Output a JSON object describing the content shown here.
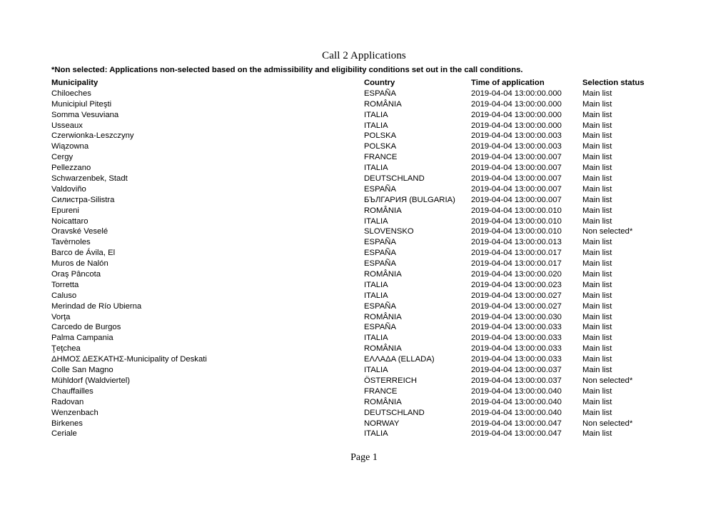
{
  "document": {
    "title": "Call 2 Applications",
    "note": "*Non selected: Applications non-selected based on the admissibility and eligibility conditions set out in the call conditions.",
    "footer": "Page 1"
  },
  "table": {
    "columns": {
      "municipality": "Municipality",
      "country": "Country",
      "time": "Time of application",
      "status": "Selection status"
    },
    "rows": [
      {
        "municipality": "Chiloeches",
        "country": "ESPAÑA",
        "time": "2019-04-04 13:00:00.000",
        "status": "Main list"
      },
      {
        "municipality": "Municipiul Piteşti",
        "country": "ROMÂNIA",
        "time": "2019-04-04 13:00:00.000",
        "status": "Main list"
      },
      {
        "municipality": "Somma Vesuviana",
        "country": "ITALIA",
        "time": "2019-04-04 13:00:00.000",
        "status": "Main list"
      },
      {
        "municipality": "Usseaux",
        "country": "ITALIA",
        "time": "2019-04-04 13:00:00.000",
        "status": "Main list"
      },
      {
        "municipality": "Czerwionka-Leszczyny",
        "country": "POLSKA",
        "time": "2019-04-04 13:00:00.003",
        "status": "Main list"
      },
      {
        "municipality": "Wiązowna",
        "country": "POLSKA",
        "time": "2019-04-04 13:00:00.003",
        "status": "Main list"
      },
      {
        "municipality": "Cergy",
        "country": "FRANCE",
        "time": "2019-04-04 13:00:00.007",
        "status": "Main list"
      },
      {
        "municipality": "Pellezzano",
        "country": "ITALIA",
        "time": "2019-04-04 13:00:00.007",
        "status": "Main list"
      },
      {
        "municipality": "Schwarzenbek, Stadt",
        "country": "DEUTSCHLAND",
        "time": "2019-04-04 13:00:00.007",
        "status": "Main list"
      },
      {
        "municipality": "Valdoviño",
        "country": "ESPAÑA",
        "time": "2019-04-04 13:00:00.007",
        "status": "Main list"
      },
      {
        "municipality": "Силистра-Silistra",
        "country": "БЪЛГАРИЯ (BULGARIA)",
        "time": "2019-04-04 13:00:00.007",
        "status": "Main list"
      },
      {
        "municipality": "Epureni",
        "country": "ROMÂNIA",
        "time": "2019-04-04 13:00:00.010",
        "status": "Main list"
      },
      {
        "municipality": "Noicattaro",
        "country": "ITALIA",
        "time": "2019-04-04 13:00:00.010",
        "status": "Main list"
      },
      {
        "municipality": "Oravské Veselé",
        "country": "SLOVENSKO",
        "time": "2019-04-04 13:00:00.010",
        "status": "Non selected*"
      },
      {
        "municipality": "Tavèrnoles",
        "country": "ESPAÑA",
        "time": "2019-04-04 13:00:00.013",
        "status": "Main list"
      },
      {
        "municipality": "Barco de Ávila, El",
        "country": "ESPAÑA",
        "time": "2019-04-04 13:00:00.017",
        "status": "Main list"
      },
      {
        "municipality": "Muros de Nalón",
        "country": "ESPAÑA",
        "time": "2019-04-04 13:00:00.017",
        "status": "Main list"
      },
      {
        "municipality": "Oraş Pâncota",
        "country": "ROMÂNIA",
        "time": "2019-04-04 13:00:00.020",
        "status": "Main list"
      },
      {
        "municipality": "Torretta",
        "country": "ITALIA",
        "time": "2019-04-04 13:00:00.023",
        "status": "Main list"
      },
      {
        "municipality": "Caluso",
        "country": "ITALIA",
        "time": "2019-04-04 13:00:00.027",
        "status": "Main list"
      },
      {
        "municipality": "Merindad de Río Ubierna",
        "country": "ESPAÑA",
        "time": "2019-04-04 13:00:00.027",
        "status": "Main list"
      },
      {
        "municipality": "Vorţa",
        "country": "ROMÂNIA",
        "time": "2019-04-04 13:00:00.030",
        "status": "Main list"
      },
      {
        "municipality": "Carcedo de Burgos",
        "country": "ESPAÑA",
        "time": "2019-04-04 13:00:00.033",
        "status": "Main list"
      },
      {
        "municipality": "Palma Campania",
        "country": "ITALIA",
        "time": "2019-04-04 13:00:00.033",
        "status": "Main list"
      },
      {
        "municipality": "Ţeţchea",
        "country": "ROMÂNIA",
        "time": "2019-04-04 13:00:00.033",
        "status": "Main list"
      },
      {
        "municipality": "ΔΗΜΟΣ ΔΕΣΚΑΤΗΣ-Municipality of Deskati",
        "country": "ΕΛΛΑΔΑ (ELLADA)",
        "time": "2019-04-04 13:00:00.033",
        "status": "Main list"
      },
      {
        "municipality": "Colle San Magno",
        "country": "ITALIA",
        "time": "2019-04-04 13:00:00.037",
        "status": "Main list"
      },
      {
        "municipality": "Mühldorf (Waldviertel)",
        "country": "ÖSTERREICH",
        "time": "2019-04-04 13:00:00.037",
        "status": "Non selected*"
      },
      {
        "municipality": "Chauffailles",
        "country": "FRANCE",
        "time": "2019-04-04 13:00:00.040",
        "status": "Main list"
      },
      {
        "municipality": "Radovan",
        "country": "ROMÂNIA",
        "time": "2019-04-04 13:00:00.040",
        "status": "Main list"
      },
      {
        "municipality": "Wenzenbach",
        "country": "DEUTSCHLAND",
        "time": "2019-04-04 13:00:00.040",
        "status": "Main list"
      },
      {
        "municipality": "Birkenes",
        "country": "NORWAY",
        "time": "2019-04-04 13:00:00.047",
        "status": "Non selected*"
      },
      {
        "municipality": "Ceriale",
        "country": "ITALIA",
        "time": "2019-04-04 13:00:00.047",
        "status": "Main list"
      }
    ]
  }
}
